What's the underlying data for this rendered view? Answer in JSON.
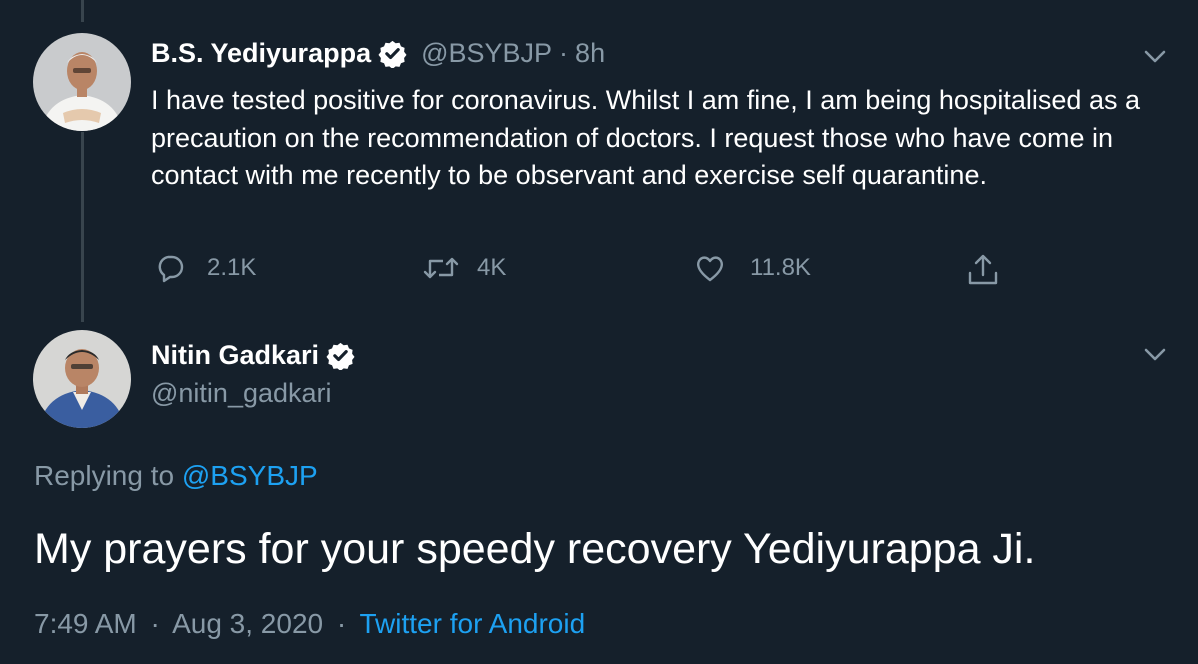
{
  "colors": {
    "background": "#15202b",
    "text_primary": "#ffffff",
    "text_secondary": "#8899a6",
    "link": "#1da1f2",
    "thread_line": "#38444d"
  },
  "original_tweet": {
    "display_name": "B.S. Yediyurappa",
    "verified_icon": "verified-badge-icon",
    "handle": "@BSYBJP",
    "separator": "·",
    "time": "8h",
    "menu_icon": "chevron-down-icon",
    "text": "I have tested positive for coronavirus. Whilst I am fine, I am being hospitalised as a precaution on the recommendation of doctors. I request those who have come in contact with me recently to be observant and exercise self quarantine.",
    "actions": {
      "reply": {
        "icon": "reply-icon",
        "count": "2.1K"
      },
      "retweet": {
        "icon": "retweet-icon",
        "count": "4K"
      },
      "like": {
        "icon": "heart-icon",
        "count": "11.8K"
      },
      "share": {
        "icon": "share-icon"
      }
    }
  },
  "reply_tweet": {
    "display_name": "Nitin Gadkari",
    "verified_icon": "verified-badge-icon",
    "handle": "@nitin_gadkari",
    "menu_icon": "chevron-down-icon",
    "replying_label": "Replying to",
    "replying_handle": "@BSYBJP",
    "text": "My prayers for your speedy recovery Yediyurappa Ji.",
    "time": "7:49 AM",
    "separator": "·",
    "date": "Aug 3, 2020",
    "source": "Twitter for Android"
  }
}
